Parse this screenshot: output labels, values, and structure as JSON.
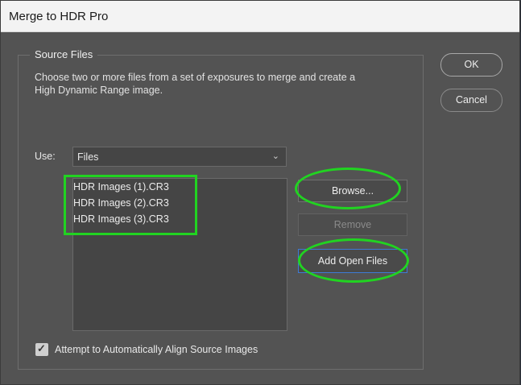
{
  "window": {
    "title": "Merge to HDR Pro"
  },
  "source_files": {
    "group_label": "Source Files",
    "description": "Choose two or more files from a set of exposures to merge and create a High Dynamic Range image.",
    "use_label": "Use:",
    "use_value": "Files",
    "files": [
      "HDR Images (1).CR3",
      "HDR Images (2).CR3",
      "HDR Images (3).CR3"
    ],
    "browse_label": "Browse...",
    "remove_label": "Remove",
    "add_open_files_label": "Add Open Files",
    "align_checkbox": {
      "label": "Attempt to Automatically Align Source Images",
      "checked": true
    }
  },
  "actions": {
    "ok_label": "OK",
    "cancel_label": "Cancel"
  },
  "annotations": {
    "highlight_color": "#21d321"
  },
  "icons": {
    "dropdown": "chevron-down-icon",
    "check": "checkmark-icon"
  }
}
